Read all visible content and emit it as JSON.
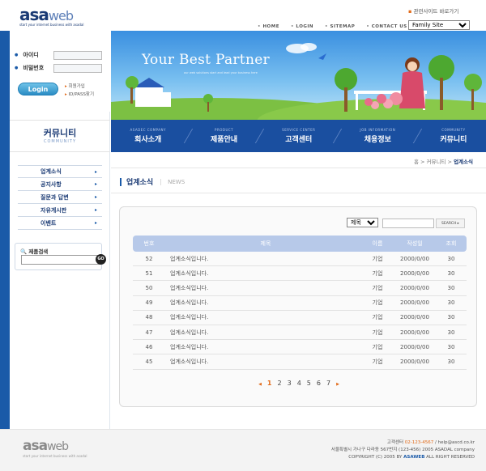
{
  "header": {
    "logo": {
      "brand_a": "asa",
      "brand_b": "web",
      "tagline": "start your internet business with asadal"
    },
    "topnav": [
      "HOME",
      "LOGIN",
      "SITEMAP",
      "CONTACT US"
    ],
    "family": {
      "label": "관련사이트 바로가기",
      "selected": "Family Site"
    }
  },
  "login": {
    "id_label": "아이디",
    "pw_label": "비밀번호",
    "button": "Login",
    "join": "회원가입",
    "find": "ID/PASS찾기"
  },
  "banner": {
    "slogan": "Your Best Partner",
    "blurb": "our web solutions start and lead your business here"
  },
  "nav": [
    {
      "en": "ASADEC COMPANY",
      "kr": "회사소개"
    },
    {
      "en": "PRODUCT",
      "kr": "제품안내"
    },
    {
      "en": "SERVICE CENTER",
      "kr": "고객센터"
    },
    {
      "en": "JOB INFORMATION",
      "kr": "채용정보"
    },
    {
      "en": "COMMUNITY",
      "kr": "커뮤니티"
    }
  ],
  "community": {
    "kr": "커뮤니티",
    "en": "COMMUNITY"
  },
  "submenu": [
    "업계소식",
    "공지사항",
    "질문과 답변",
    "자유게시판",
    "이벤트"
  ],
  "product_search": {
    "label": "제품검색",
    "go": "GO"
  },
  "breadcrumb": {
    "home": "홈",
    "sep": ">",
    "level1": "커뮤니티",
    "current": "업계소식"
  },
  "page_title": {
    "kr": "업계소식",
    "en": "NEWS"
  },
  "board": {
    "search_select": "제목",
    "search_button": "SEARCH ▸",
    "columns": [
      "번호",
      "제목",
      "이름",
      "작성일",
      "조회"
    ],
    "rows": [
      {
        "num": "52",
        "title": "업계소식입니다.",
        "name": "기업",
        "date": "2000/0/00",
        "views": "30"
      },
      {
        "num": "51",
        "title": "업계소식입니다.",
        "name": "기업",
        "date": "2000/0/00",
        "views": "30"
      },
      {
        "num": "50",
        "title": "업계소식입니다.",
        "name": "기업",
        "date": "2000/0/00",
        "views": "30"
      },
      {
        "num": "49",
        "title": "업계소식입니다.",
        "name": "기업",
        "date": "2000/0/00",
        "views": "30"
      },
      {
        "num": "48",
        "title": "업계소식입니다.",
        "name": "기업",
        "date": "2000/0/00",
        "views": "30"
      },
      {
        "num": "47",
        "title": "업계소식입니다.",
        "name": "기업",
        "date": "2000/0/00",
        "views": "30"
      },
      {
        "num": "46",
        "title": "업계소식입니다.",
        "name": "기업",
        "date": "2000/0/00",
        "views": "30"
      },
      {
        "num": "45",
        "title": "업계소식입니다.",
        "name": "기업",
        "date": "2000/0/00",
        "views": "30"
      }
    ],
    "pages": [
      "1",
      "2",
      "3",
      "4",
      "5",
      "6",
      "7"
    ],
    "current_page": "1"
  },
  "footer": {
    "logo": {
      "brand_a": "asa",
      "brand_b": "web",
      "tagline": "start your internet business with asadal"
    },
    "line1_prefix": "고객센터",
    "line1_phone": "02-123-4567",
    "line1_email": "/ help@ascd.co.kr",
    "line2": "서울특별시 가나구 다라동 567번지 (123-456) 2005 ASADAL company",
    "line3_prefix": "COPYRIGHT (C) 2005 BY",
    "line3_brand": "ASAWEB",
    "line3_suffix": "ALL RIGHT RESERVED"
  }
}
